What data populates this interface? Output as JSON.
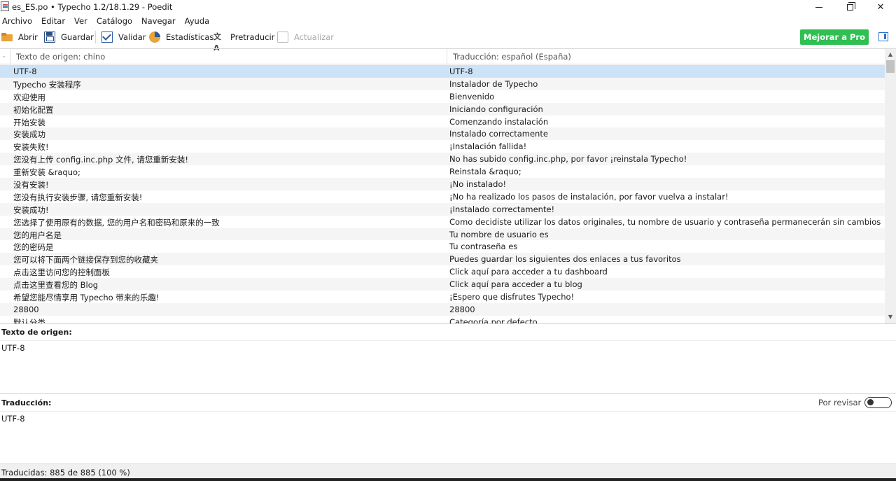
{
  "window": {
    "title": "es_ES.po • Typecho 1.2/18.1.29 - Poedit"
  },
  "menu": [
    "Archivo",
    "Editar",
    "Ver",
    "Catálogo",
    "Navegar",
    "Ayuda"
  ],
  "toolbar": {
    "open": "Abrir",
    "save": "Guardar",
    "validate": "Validar",
    "stats": "Estadísticas",
    "pretranslate": "Pretraducir",
    "update": "Actualizar",
    "pro": "Mejorar a Pro"
  },
  "list": {
    "header_source": "Texto de origen: chino",
    "header_translation": "Traducción: español (España)",
    "rows": [
      {
        "src": "UTF-8",
        "trans": "UTF-8"
      },
      {
        "src": "Typecho 安装程序",
        "trans": "Instalador de Typecho"
      },
      {
        "src": "欢迎使用",
        "trans": "Bienvenido"
      },
      {
        "src": "初始化配置",
        "trans": "Iniciando configuración"
      },
      {
        "src": "开始安装",
        "trans": "Comenzando instalación"
      },
      {
        "src": "安装成功",
        "trans": "Instalado correctamente"
      },
      {
        "src": "安装失败!",
        "trans": "¡Instalación fallida!"
      },
      {
        "src": "您没有上传 config.inc.php 文件, 请您重新安装!",
        "trans": "No has subido config.inc.php, por favor ¡reinstala Typecho!"
      },
      {
        "src": "重新安装 &raquo;",
        "trans": "Reinstala &raquo;"
      },
      {
        "src": "没有安装!",
        "trans": "¡No instalado!"
      },
      {
        "src": "您没有执行安装步骤, 请您重新安装!",
        "trans": "¡No ha realizado los pasos de instalación, por favor vuelva a instalar!"
      },
      {
        "src": "安装成功!",
        "trans": "¡Instalado correctamente!"
      },
      {
        "src": "您选择了使用原有的数据, 您的用户名和密码和原来的一致",
        "trans": "Como decidiste utilizar los datos originales, tu nombre de usuario y contraseña permanecerán sin cambios"
      },
      {
        "src": "您的用户名是",
        "trans": "Tu nombre de usuario es"
      },
      {
        "src": "您的密码是",
        "trans": "Tu contraseña es"
      },
      {
        "src": "您可以将下面两个链接保存到您的收藏夹",
        "trans": "Puedes guardar los siguientes dos enlaces a tus favoritos"
      },
      {
        "src": "点击这里访问您的控制面板",
        "trans": "Click aquí para acceder a tu dashboard"
      },
      {
        "src": "点击这里查看您的 Blog",
        "trans": "Click aquí para acceder a tu blog"
      },
      {
        "src": "希望您能尽情享用 Typecho 带来的乐趣!",
        "trans": "¡Espero que disfrutes Typecho!"
      },
      {
        "src": "28800",
        "trans": "28800"
      },
      {
        "src": "默认分类",
        "trans": "Categoría por defecto"
      }
    ]
  },
  "source_pane": {
    "label": "Texto de origen:",
    "text": "UTF-8"
  },
  "translation_pane": {
    "label": "Traducción:",
    "text": "UTF-8",
    "review_label": "Por revisar"
  },
  "status": "Traducidas: 885 de 885 (100 %)",
  "colors": {
    "selected_row": "#cce2f7",
    "pro_button": "#2fbf52",
    "accent": "#2b72c9"
  }
}
